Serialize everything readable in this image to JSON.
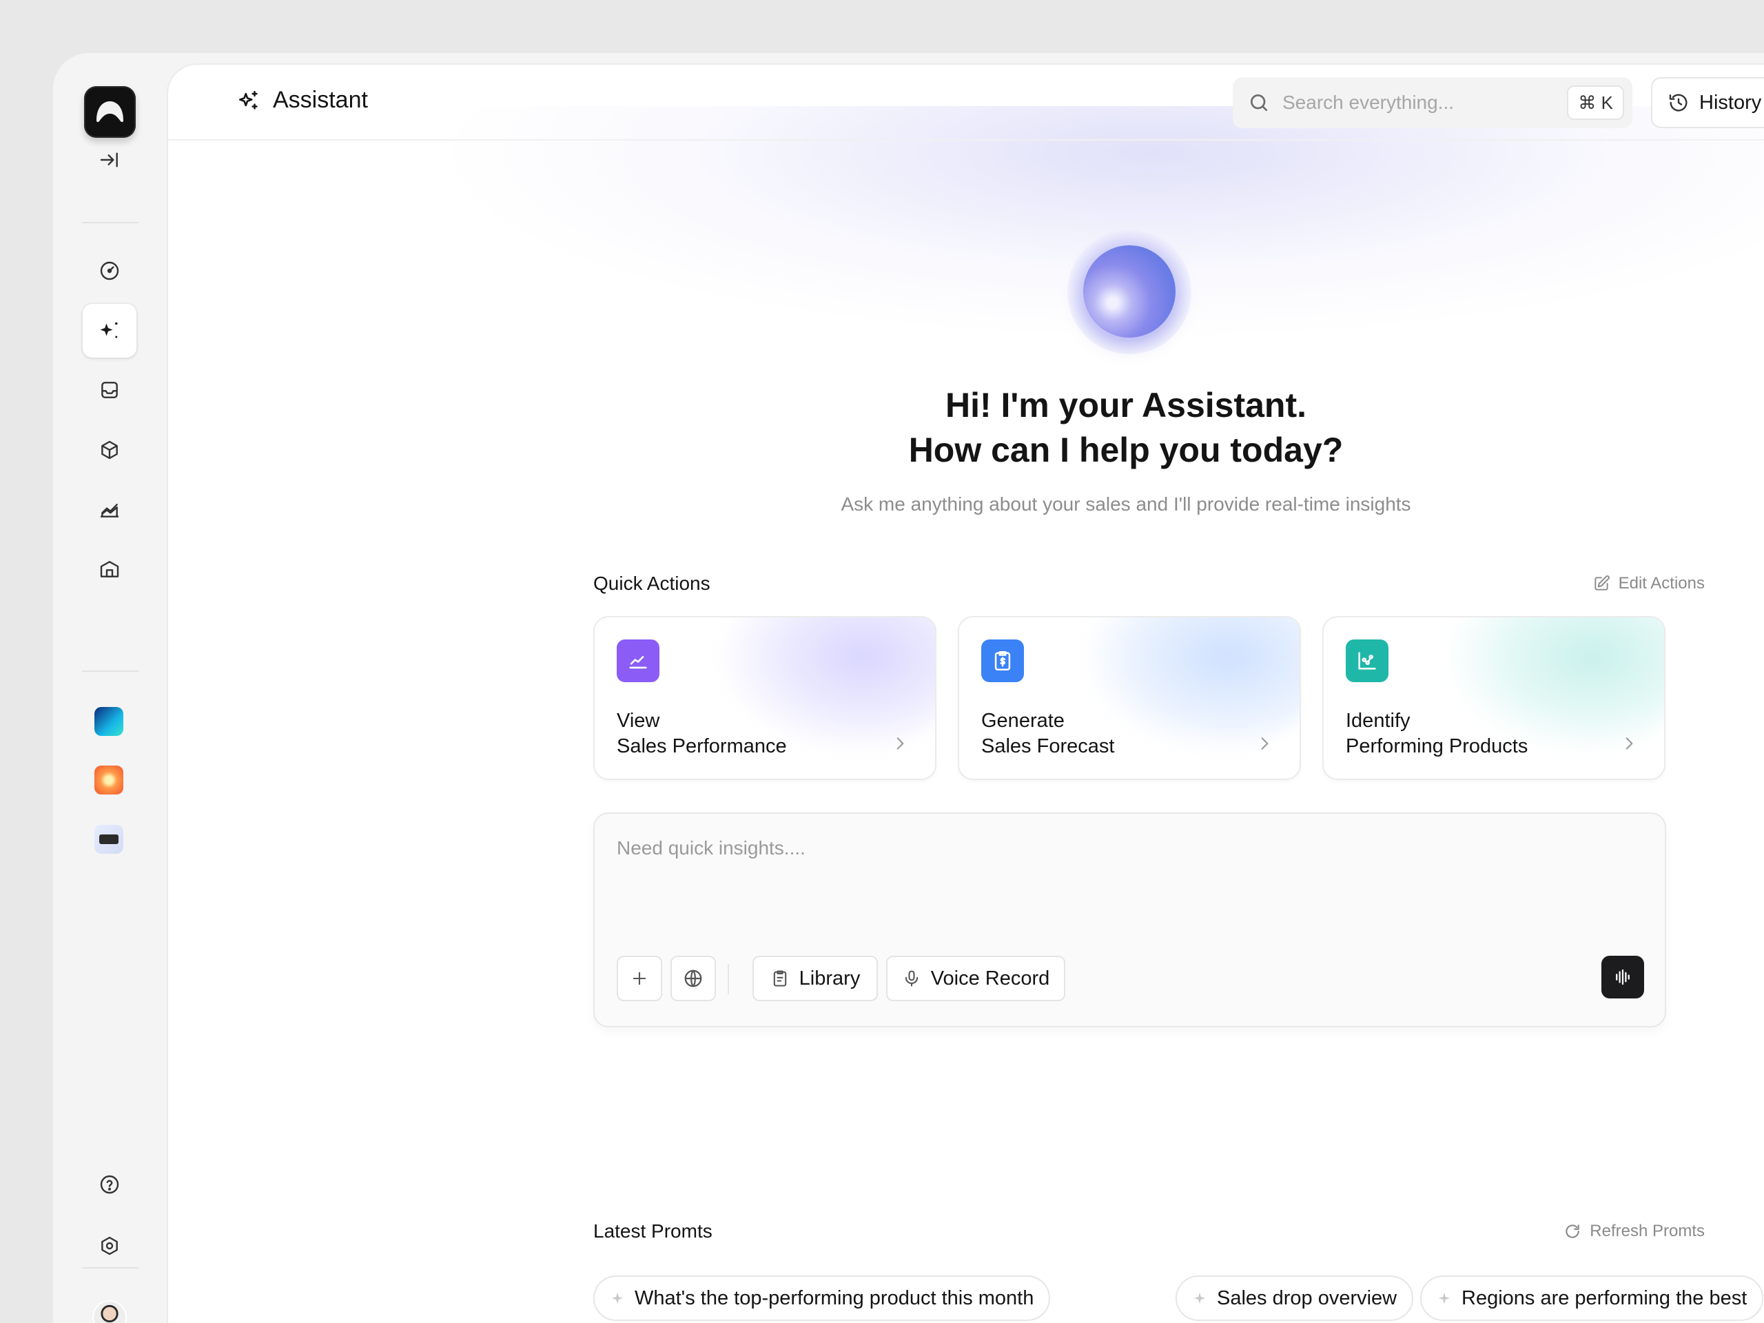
{
  "app": {
    "title": "Assistant"
  },
  "sidebar": {
    "items": [
      {
        "name": "collapse-icon"
      },
      {
        "name": "dashboard-icon"
      },
      {
        "name": "assistant-sparkle-icon",
        "active": true
      },
      {
        "name": "inbox-icon"
      },
      {
        "name": "package-icon"
      },
      {
        "name": "analytics-icon"
      },
      {
        "name": "store-icon"
      }
    ],
    "apps": [
      {
        "name": "app-gradient-icon",
        "colors": [
          "#20c7e8",
          "#1a2b6a"
        ]
      },
      {
        "name": "app-sunburst-icon",
        "colors": [
          "#ff8a3d",
          "#f25a2a"
        ]
      },
      {
        "name": "app-badge-icon",
        "colors": [
          "#dfe6ff",
          "#2b2b2b"
        ]
      }
    ],
    "bottom": [
      {
        "name": "help-icon"
      },
      {
        "name": "settings-hexagon-icon"
      }
    ]
  },
  "header": {
    "search": {
      "placeholder": "Search everything...",
      "value": "",
      "shortcut": "⌘ K"
    },
    "history_label": "History"
  },
  "hero": {
    "line1": "Hi! I'm your Assistant.",
    "line2": "How can I help you today?",
    "subtitle": "Ask me anything about your sales and I'll provide real-time insights"
  },
  "quick_actions": {
    "title": "Quick Actions",
    "edit_label": "Edit Actions",
    "cards": [
      {
        "line1": "View",
        "line2": "Sales Performance",
        "accent": "#8b5cf6",
        "tint": "#d9d6ff"
      },
      {
        "line1": "Generate",
        "line2": "Sales Forecast",
        "accent": "#3b82f6",
        "tint": "#cfe1ff"
      },
      {
        "line1": "Identify",
        "line2": "Performing Products",
        "accent": "#1fb8a8",
        "tint": "#c9f1ec"
      }
    ]
  },
  "composer": {
    "placeholder": "Need quick insights....",
    "value": "",
    "library_label": "Library",
    "voice_label": "Voice Record"
  },
  "latest_prompts": {
    "title": "Latest Promts",
    "refresh_label": "Refresh Promts",
    "chips": [
      "What's the top-performing product this month",
      "Sales drop overview",
      "Regions are performing the best"
    ]
  }
}
